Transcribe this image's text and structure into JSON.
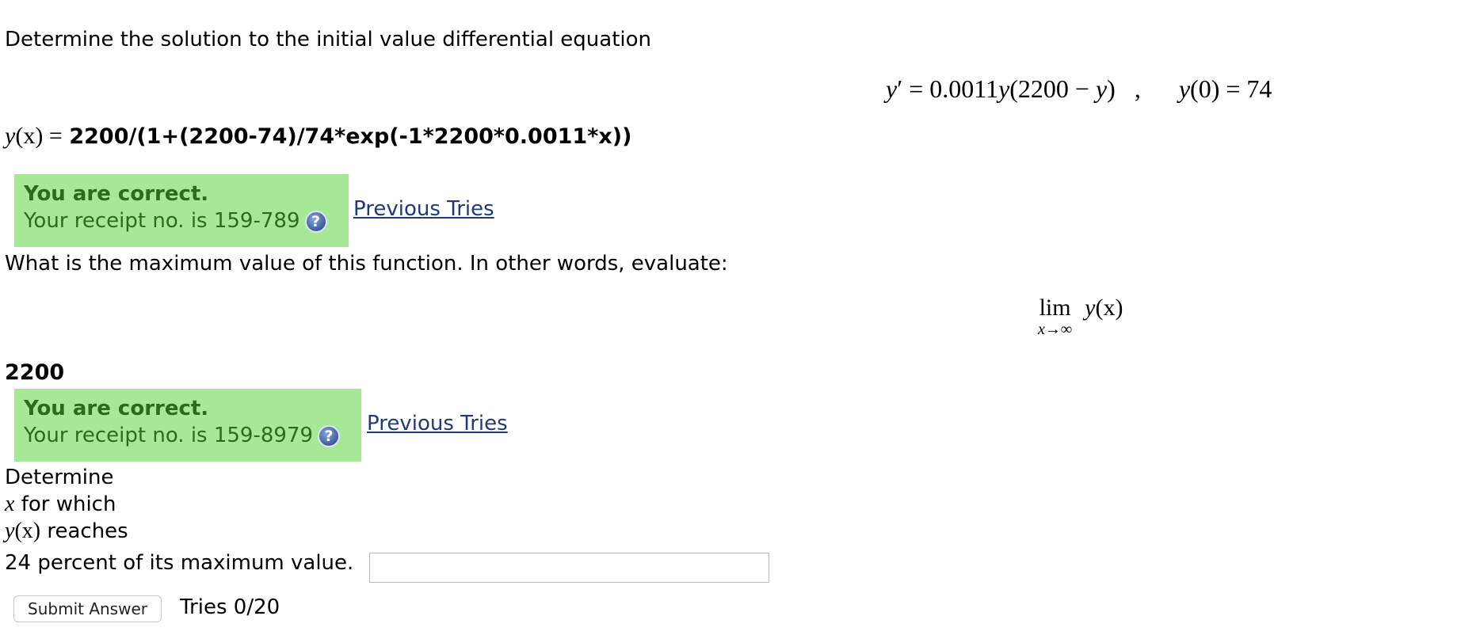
{
  "problem": {
    "intro": "Determine the solution to the initial value differential equation",
    "equation": {
      "lhs": "y",
      "prime": "′",
      "equals": "=",
      "coef": "0.0011",
      "y_var": "y",
      "paren_open": "(2200 − ",
      "y_var2": "y",
      "paren_close": ")",
      "comma": ",",
      "init_fn": "y",
      "init_arg": "(0) = 74"
    },
    "solution_label_fn": "y",
    "solution_label_arg": "(x)",
    "solution_label_eq": " =",
    "solution_answer": "2200/(1+(2200-74)/74*exp(-1*2200*0.0011*x))"
  },
  "feedback1": {
    "title": "You are correct.",
    "receipt": "Your receipt no. is 159-789",
    "help_icon": "question-help-icon",
    "previous_tries": "Previous Tries"
  },
  "part2": {
    "prompt": "What is the maximum value of this function. In other words, evaluate:",
    "limit": {
      "lim": "lim",
      "sub": "x→∞",
      "fn": "y",
      "arg": "(x)"
    },
    "answer": "2200"
  },
  "feedback2": {
    "title": "You are correct.",
    "receipt": "Your receipt no. is 159-8979",
    "help_icon": "question-help-icon",
    "previous_tries": "Previous Tries"
  },
  "part3": {
    "line1": "Determine",
    "line2_var": "x",
    "line2_text": " for which",
    "line3_var": "y",
    "line3_arg": "(x)",
    "line3_text": " reaches",
    "line4": "24 percent of its maximum value.",
    "input_value": ""
  },
  "submit": {
    "label": "Submit Answer",
    "tries": "Tries 0/20"
  }
}
